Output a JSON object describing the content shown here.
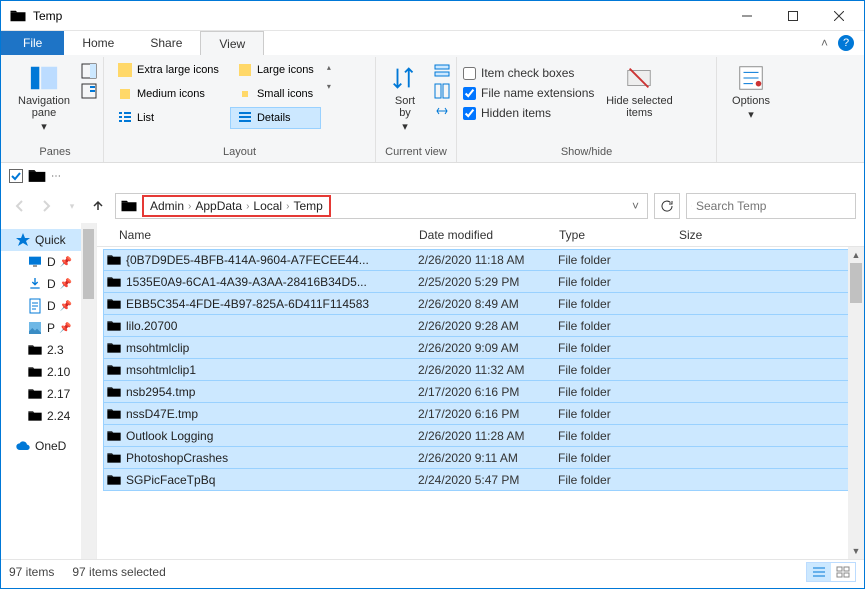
{
  "window": {
    "title": "Temp"
  },
  "menu": {
    "file": "File",
    "home": "Home",
    "share": "Share",
    "view": "View"
  },
  "ribbon": {
    "panes_group": "Panes",
    "layout_group": "Layout",
    "currentview_group": "Current view",
    "showhide_group": "Show/hide",
    "navigation_pane": "Navigation\npane",
    "extra_large": "Extra large icons",
    "large": "Large icons",
    "medium": "Medium icons",
    "small": "Small icons",
    "list": "List",
    "details": "Details",
    "sort_by": "Sort\nby",
    "item_check": "Item check boxes",
    "file_ext": "File name extensions",
    "hidden": "Hidden items",
    "hide_selected": "Hide selected\nitems",
    "options": "Options"
  },
  "breadcrumb": [
    "Admin",
    "AppData",
    "Local",
    "Temp"
  ],
  "search": {
    "placeholder": "Search Temp"
  },
  "columns": {
    "name": "Name",
    "date": "Date modified",
    "type": "Type",
    "size": "Size"
  },
  "sidebar": {
    "quick": "Quick",
    "d1": "D",
    "d2": "D",
    "d3": "D",
    "p": "P",
    "s23": "2.3",
    "s210": "2.10",
    "s217": "2.17",
    "s224": "2.24",
    "oned": "OneD"
  },
  "rows": [
    {
      "name": "{0B7D9DE5-4BFB-414A-9604-A7FECEE44...",
      "date": "2/26/2020 11:18 AM",
      "type": "File folder"
    },
    {
      "name": "1535E0A9-6CA1-4A39-A3AA-28416B34D5...",
      "date": "2/25/2020 5:29 PM",
      "type": "File folder"
    },
    {
      "name": "EBB5C354-4FDE-4B97-825A-6D411F114583",
      "date": "2/26/2020 8:49 AM",
      "type": "File folder"
    },
    {
      "name": "lilo.20700",
      "date": "2/26/2020 9:28 AM",
      "type": "File folder"
    },
    {
      "name": "msohtmlclip",
      "date": "2/26/2020 9:09 AM",
      "type": "File folder"
    },
    {
      "name": "msohtmlclip1",
      "date": "2/26/2020 11:32 AM",
      "type": "File folder"
    },
    {
      "name": "nsb2954.tmp",
      "date": "2/17/2020 6:16 PM",
      "type": "File folder"
    },
    {
      "name": "nssD47E.tmp",
      "date": "2/17/2020 6:16 PM",
      "type": "File folder"
    },
    {
      "name": "Outlook Logging",
      "date": "2/26/2020 11:28 AM",
      "type": "File folder"
    },
    {
      "name": "PhotoshopCrashes",
      "date": "2/26/2020 9:11 AM",
      "type": "File folder"
    },
    {
      "name": "SGPicFaceTpBq",
      "date": "2/24/2020 5:47 PM",
      "type": "File folder"
    }
  ],
  "status": {
    "items": "97 items",
    "selected": "97 items selected"
  }
}
